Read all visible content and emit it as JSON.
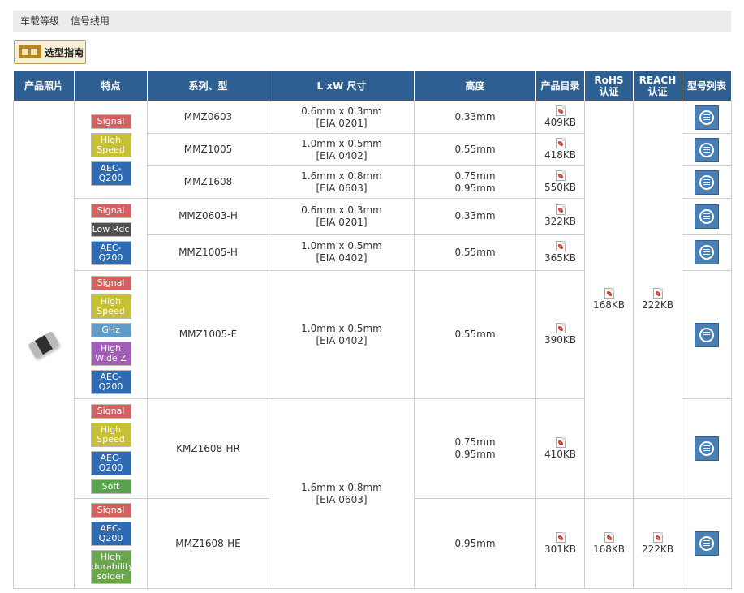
{
  "breadcrumb": [
    "车载等级",
    "信号线用"
  ],
  "guide_button": "选型指南",
  "headers": {
    "photo": "产品照片",
    "features": "特点",
    "series": "系列、型",
    "size": "L xW 尺寸",
    "height": "高度",
    "catalog": "产品目录",
    "rohs_1": "RoHS",
    "rohs_2": "认证",
    "reach_1": "REACH",
    "reach_2": "认证",
    "list": "型号列表"
  },
  "badges": {
    "signal": "Signal",
    "high": "High",
    "speed": "Speed",
    "aec1": "AEC-",
    "aec2": "Q200",
    "low_rdc": "Low Rdc",
    "ghz": "GHz",
    "wide": "Wide Z",
    "soft": "Soft",
    "durability": "durability",
    "solder": "solder"
  },
  "rows": [
    {
      "series": "MMZ0603",
      "size1": "0.6mm x 0.3mm",
      "size2": "[EIA 0201]",
      "height1": "0.33mm",
      "height2": "",
      "catalog": "409KB"
    },
    {
      "series": "MMZ1005",
      "size1": "1.0mm x 0.5mm",
      "size2": "[EIA 0402]",
      "height1": "0.55mm",
      "height2": "",
      "catalog": "418KB"
    },
    {
      "series": "MMZ1608",
      "size1": "1.6mm x 0.8mm",
      "size2": "[EIA 0603]",
      "height1": "0.75mm",
      "height2": "0.95mm",
      "catalog": "550KB"
    },
    {
      "series": "MMZ0603-H",
      "size1": "0.6mm x 0.3mm",
      "size2": "[EIA 0201]",
      "height1": "0.33mm",
      "height2": "",
      "catalog": "322KB"
    },
    {
      "series": "MMZ1005-H",
      "size1": "1.0mm x 0.5mm",
      "size2": "[EIA 0402]",
      "height1": "0.55mm",
      "height2": "",
      "catalog": "365KB"
    },
    {
      "series": "MMZ1005-E",
      "size1": "1.0mm x 0.5mm",
      "size2": "[EIA 0402]",
      "height1": "0.55mm",
      "height2": "",
      "catalog": "390KB"
    },
    {
      "series": "KMZ1608-HR",
      "size1": "1.6mm x 0.8mm",
      "size2": "[EIA 0603]",
      "height1": "0.75mm",
      "height2": "0.95mm",
      "catalog": "410KB"
    },
    {
      "series": "MMZ1608-HE",
      "size1": "",
      "size2": "",
      "height1": "0.95mm",
      "height2": "",
      "catalog": "301KB"
    }
  ],
  "rohs": {
    "main": "168KB",
    "he": "168KB"
  },
  "reach": {
    "main": "222KB",
    "he": "222KB"
  }
}
